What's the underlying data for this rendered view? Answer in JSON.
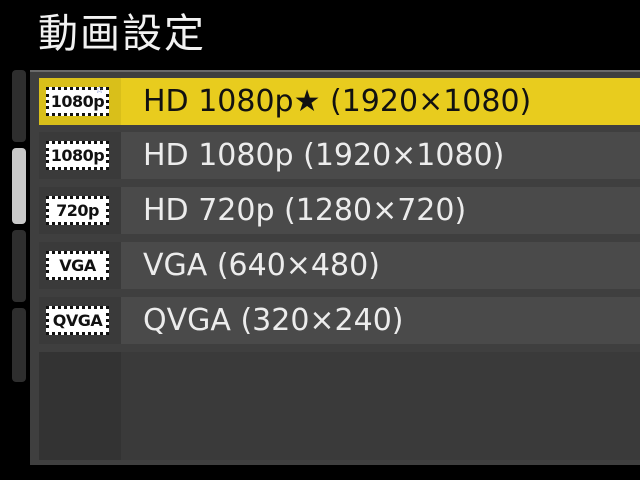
{
  "header": {
    "title": "動画設定"
  },
  "menu": {
    "items": [
      {
        "icon_text": "1080p",
        "icon": "hd-1080p-star-icon",
        "label": "HD 1080p★ (1920×1080)",
        "selected": true
      },
      {
        "icon_text": "1080p",
        "icon": "hd-1080p-icon",
        "label": "HD 1080p (1920×1080)",
        "selected": false
      },
      {
        "icon_text": "720p",
        "icon": "hd-720p-icon",
        "label": "HD 720p (1280×720)",
        "selected": false
      },
      {
        "icon_text": "VGA",
        "icon": "vga-icon",
        "label": "VGA (640×480)",
        "selected": false
      },
      {
        "icon_text": "QVGA",
        "icon": "qvga-icon",
        "label": "QVGA (320×240)",
        "selected": false
      }
    ]
  },
  "colors": {
    "highlight": "#e8cc1e",
    "row_background": "#4a4a4a",
    "panel_background": "#3f3f3f",
    "text": "#ececec"
  }
}
